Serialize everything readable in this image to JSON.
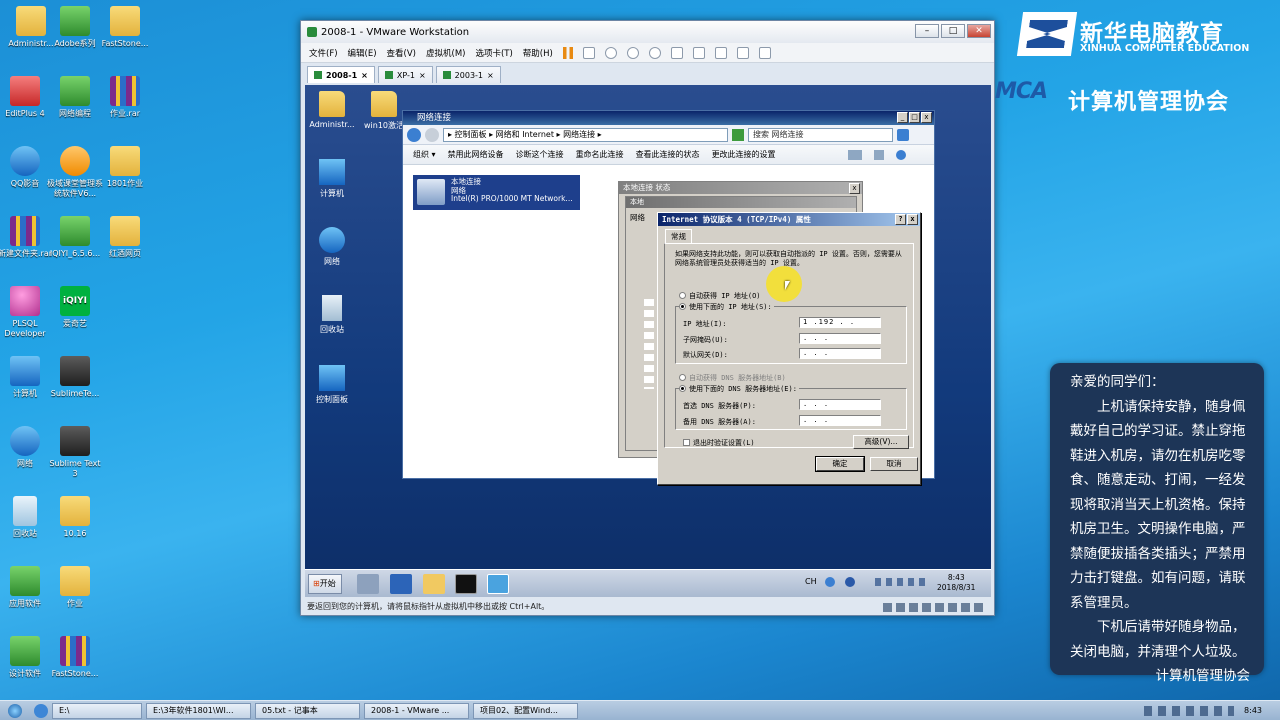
{
  "desktop": {
    "icons": [
      {
        "label": "Administr..."
      },
      {
        "label": "Adobe系列"
      },
      {
        "label": "FastStone..."
      },
      {
        "label": "EditPlus 4"
      },
      {
        "label": "网络编程"
      },
      {
        "label": "作业.rar"
      },
      {
        "label": "QQ影音"
      },
      {
        "label": "极域课堂管理系统软件V6..."
      },
      {
        "label": "1801作业"
      },
      {
        "label": "新建文件夹.rar"
      },
      {
        "label": "IQIYI_6.5.6..."
      },
      {
        "label": "红酒网页"
      },
      {
        "label": "PLSQL Developer"
      },
      {
        "label": "爱奇艺"
      },
      {
        "label": "计算机"
      },
      {
        "label": "SublimeTe..."
      },
      {
        "label": "网络"
      },
      {
        "label": "Sublime Text 3"
      },
      {
        "label": "回收站"
      },
      {
        "label": "10.16"
      },
      {
        "label": "应用软件"
      },
      {
        "label": "作业"
      },
      {
        "label": "设计软件"
      },
      {
        "label": "FastStone..."
      }
    ]
  },
  "vmware": {
    "title": "2008-1 - VMware Workstation",
    "menu": [
      "文件(F)",
      "编辑(E)",
      "查看(V)",
      "虚拟机(M)",
      "选项卡(T)",
      "帮助(H)"
    ],
    "tabs": [
      {
        "label": "2008-1",
        "active": true
      },
      {
        "label": "XP-1",
        "active": false
      },
      {
        "label": "2003-1",
        "active": false
      }
    ],
    "status": "要返回到您的计算机，请将鼠标指针从虚拟机中移出或按 Ctrl+Alt。"
  },
  "guest": {
    "desktop_icons": [
      {
        "label": "Administr..."
      },
      {
        "label": "win10激活"
      },
      {
        "label": "计算机"
      },
      {
        "label": "网络"
      },
      {
        "label": "回收站"
      },
      {
        "label": "控制面板"
      }
    ],
    "net_window": {
      "title": "网络连接",
      "breadcrumb": "▸ 控制面板 ▸ 网络和 Internet ▸ 网络连接 ▸",
      "search_placeholder": "搜索 网络连接",
      "commands": [
        "组织 ▾",
        "禁用此网络设备",
        "诊断这个连接",
        "重命名此连接",
        "查看此连接的状态",
        "更改此连接的设置"
      ],
      "connection": {
        "name": "本地连接",
        "type": "网络",
        "adapter": "Intel(R) PRO/1000 MT Network..."
      }
    },
    "props_window": {
      "title": "本地连接 状态",
      "title2": "本地",
      "tab": "网络"
    },
    "tcp_dialog": {
      "title": "Internet 协议版本 4 (TCP/IPv4) 属性",
      "tab": "常规",
      "description": "如果网络支持此功能，则可以获取自动指派的 IP 设置。否则，您需要从网络系统管理员处获得适当的 IP 设置。",
      "auto_ip": "自动获得 IP 地址(O)",
      "manual_ip": "使用下面的 IP 地址(S):",
      "ip_label": "IP 地址(I):",
      "ip_value": "1 .192 .  .",
      "mask_label": "子网掩码(U):",
      "mask_value": ".   .   .",
      "gateway_label": "默认网关(D):",
      "gateway_value": ".   .   .",
      "auto_dns": "自动获得 DNS 服务器地址(B)",
      "manual_dns": "使用下面的 DNS 服务器地址(E):",
      "dns1_label": "首选 DNS 服务器(P):",
      "dns1_value": ".   .   .",
      "dns2_label": "备用 DNS 服务器(A):",
      "dns2_value": ".   .   .",
      "validate": "退出时验证设置(L)",
      "advanced": "高级(V)...",
      "ok": "确定",
      "cancel": "取消"
    },
    "taskbar": {
      "start": "开始",
      "lang": "CH",
      "time": "8:43",
      "date": "2018/8/31"
    }
  },
  "branding": {
    "logo_title": "新华电脑教育",
    "logo_subtitle": "XINHUA COMPUTER EDUCATION",
    "club_mark": "MCA",
    "club": "计算机管理协会"
  },
  "notice": {
    "greeting": "亲爱的同学们：",
    "para1": "上机请保持安静，随身佩戴好自己的学习证。禁止穿拖鞋进入机房，请勿在机房吃零食、随意走动、打闹，一经发现将取消当天上机资格。保持机房卫生。文明操作电脑，严禁随便拔插各类插头；严禁用力击打键盘。如有问题，请联系管理员。",
    "para2": "下机后请带好随身物品，关闭电脑，并清理个人垃圾。",
    "signature": "计算机管理协会"
  },
  "host_taskbar": {
    "items": [
      "E:\\",
      "E:\\3年软件1801\\WI...",
      "05.txt - 记事本",
      "2008-1 - VMware ...",
      "项目02、配置Wind..."
    ],
    "time": "8:43"
  }
}
